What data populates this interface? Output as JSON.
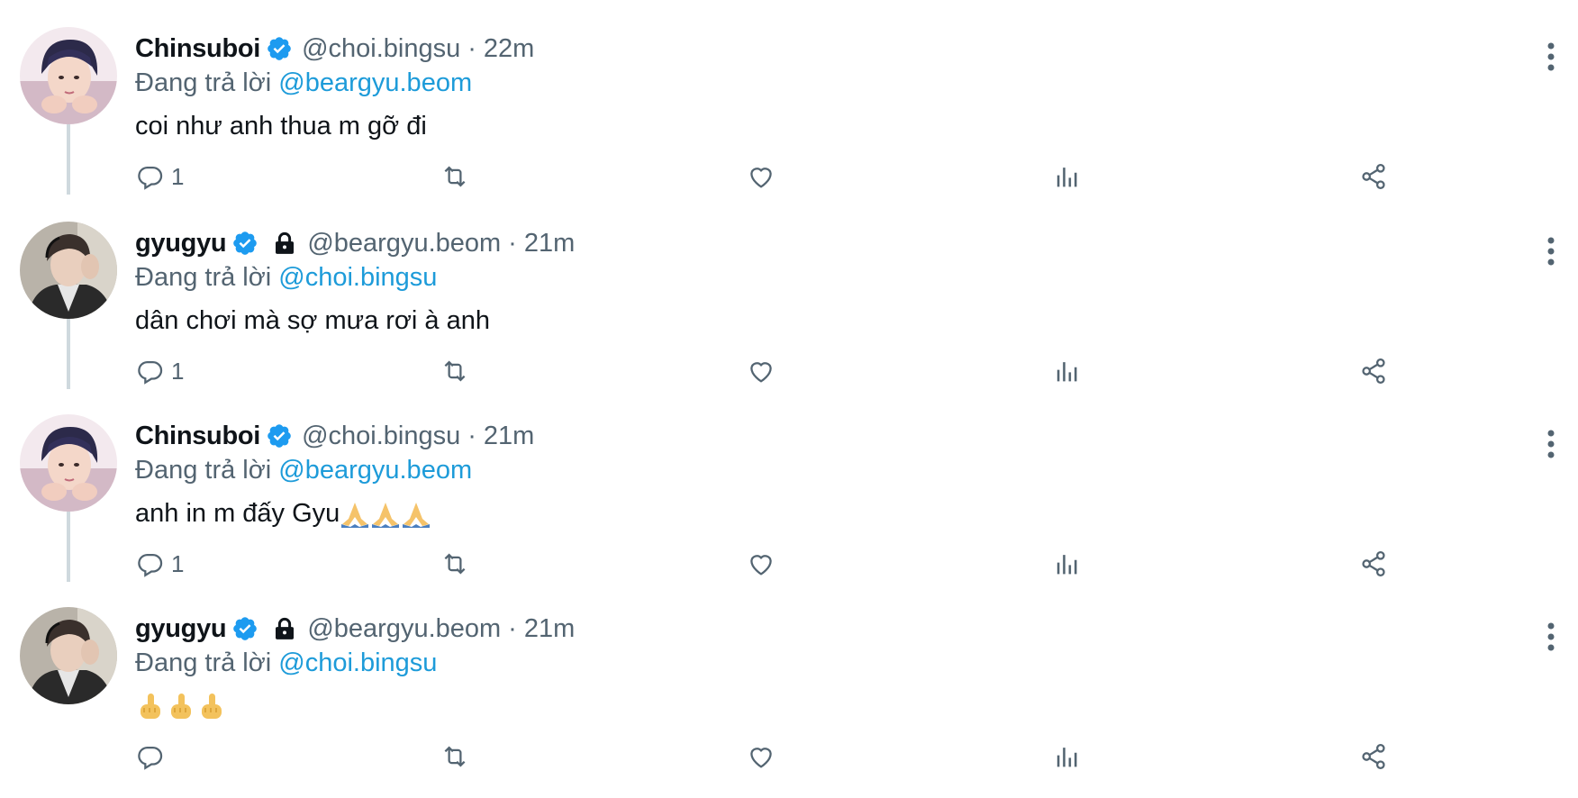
{
  "colors": {
    "accent": "#1d9bd9",
    "muted": "#536471",
    "text": "#0f1419",
    "thread": "#cfd9de",
    "verified": "#1d9bf0"
  },
  "tweets": [
    {
      "name": "Chinsuboi",
      "handle": "@choi.bingsu",
      "separator": "·",
      "time": "22m",
      "reply_prefix": "Đang trả lời",
      "reply_to": "@beargyu.beom",
      "text": "coi như anh thua m gỡ đi",
      "reply_count": "1",
      "avatar": "avatar-chinsuboi",
      "protected": false
    },
    {
      "name": "gyugyu",
      "handle": "@beargyu.beom",
      "separator": "·",
      "time": "21m",
      "reply_prefix": "Đang trả lời",
      "reply_to": "@choi.bingsu",
      "text": "dân chơi mà sợ mưa rơi à anh",
      "reply_count": "1",
      "avatar": "avatar-gyugyu",
      "protected": true
    },
    {
      "name": "Chinsuboi",
      "handle": "@choi.bingsu",
      "separator": "·",
      "time": "21m",
      "reply_prefix": "Đang trả lời",
      "reply_to": "@beargyu.beom",
      "text": "anh in m đấy Gyu",
      "emoji": "praying-hands x3",
      "reply_count": "1",
      "avatar": "avatar-chinsuboi",
      "protected": false
    },
    {
      "name": "gyugyu",
      "handle": "@beargyu.beom",
      "separator": "·",
      "time": "21m",
      "reply_prefix": "Đang trả lời",
      "reply_to": "@choi.bingsu",
      "text": "",
      "emoji": "hand-gesture x3",
      "reply_count": "",
      "avatar": "avatar-gyugyu",
      "protected": true
    }
  ],
  "icons": [
    "reply-icon",
    "retweet-icon",
    "like-icon",
    "views-icon",
    "share-icon",
    "more-options-icon",
    "verified-badge-icon",
    "lock-icon"
  ]
}
